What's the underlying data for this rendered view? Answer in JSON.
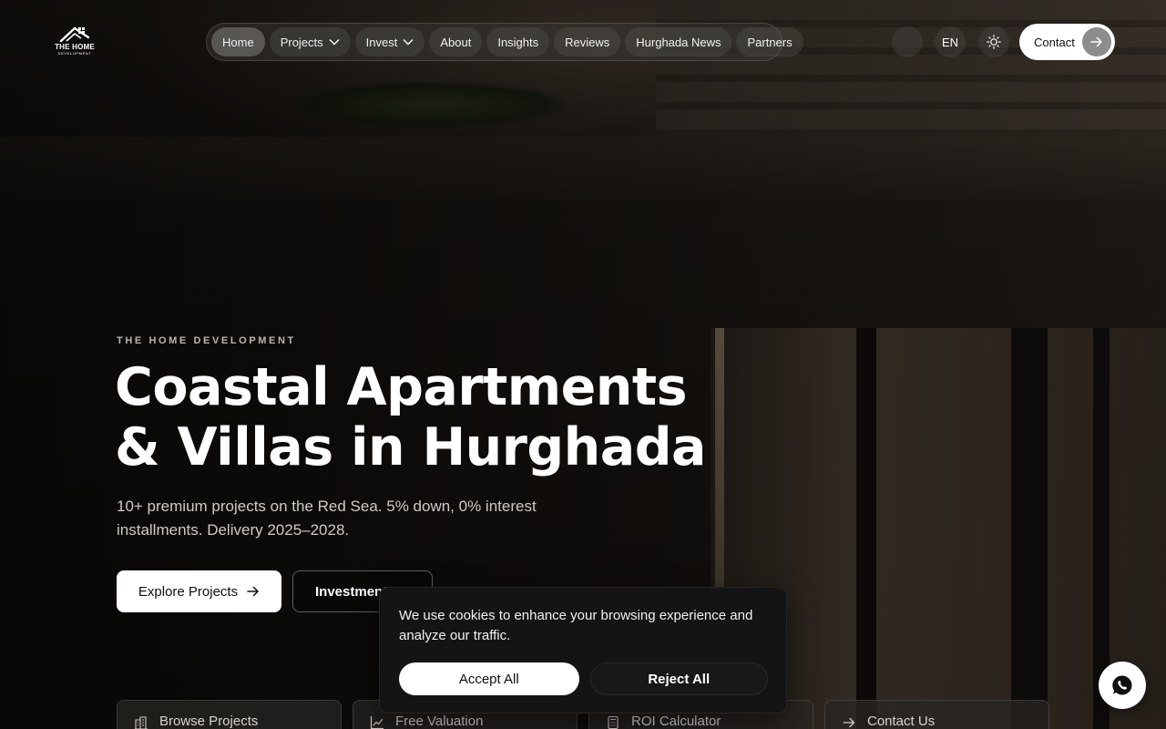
{
  "brand": {
    "line1": "THE HOME",
    "line2": "DEVELOPMENT"
  },
  "nav": {
    "items": [
      {
        "label": "Home",
        "active": true
      },
      {
        "label": "Projects",
        "dropdown": true
      },
      {
        "label": "Invest",
        "dropdown": true
      },
      {
        "label": "About"
      },
      {
        "label": "Insights"
      },
      {
        "label": "Reviews"
      },
      {
        "label": "Hurghada News"
      },
      {
        "label": "Partners"
      }
    ]
  },
  "header": {
    "language": "EN",
    "contact_label": "Contact",
    "theme_icon": "sun-icon"
  },
  "hero": {
    "eyebrow": "THE HOME DEVELOPMENT",
    "headline_line1": "Coastal Apartments",
    "headline_line2": "& Villas in Hurghada",
    "subtitle": "10+ premium projects on the Red Sea. 5% down, 0% interest installments. Delivery 2025–2028.",
    "primary_cta": "Explore Projects",
    "secondary_cta": "Investment..."
  },
  "quick_links": [
    {
      "label": "Browse Projects",
      "icon": "building-icon"
    },
    {
      "label": "Free Valuation",
      "icon": "chart-line-icon"
    },
    {
      "label": "ROI Calculator",
      "icon": "calculator-icon"
    },
    {
      "label": "Contact Us",
      "icon": "arrow-right-icon"
    }
  ],
  "cookie": {
    "message": "We use cookies to enhance your browsing experience and analyze our traffic.",
    "accept_label": "Accept All",
    "reject_label": "Reject All"
  },
  "colors": {
    "accent": "#ffffff",
    "panel": "#141414"
  }
}
